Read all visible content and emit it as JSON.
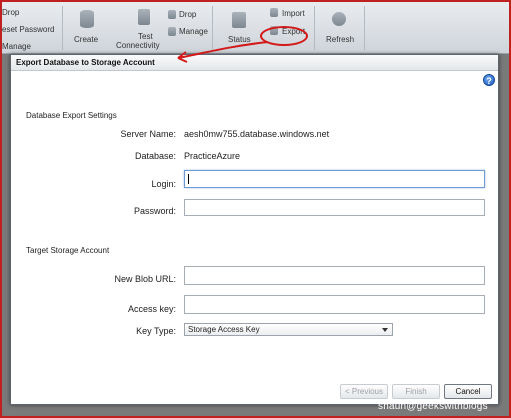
{
  "ribbon": {
    "items": {
      "drop_left": "Drop",
      "reset_password": "eset Password",
      "manage_left": "Manage",
      "create": "Create",
      "test_connectivity_1": "Test",
      "test_connectivity_2": "Connectivity",
      "drop": "Drop",
      "manage": "Manage",
      "status": "Status",
      "import": "Import",
      "export": "Export",
      "refresh": "Refresh"
    },
    "annotation_color": "#d21a1a"
  },
  "dialog": {
    "title": "Export Database to Storage Account",
    "help_icon": "?",
    "export_settings": {
      "section_title": "Database Export Settings",
      "server_name_label": "Server Name:",
      "server_name_value": "aesh0mw755.database.windows.net",
      "database_label": "Database:",
      "database_value": "PracticeAzure",
      "login_label": "Login:",
      "login_value": "",
      "password_label": "Password:",
      "password_value": ""
    },
    "storage": {
      "section_title": "Target Storage Account",
      "blob_url_label": "New Blob URL:",
      "blob_url_value": "",
      "access_key_label": "Access key:",
      "access_key_value": "",
      "key_type_label": "Key Type:",
      "key_type_selected": "Storage Access Key"
    },
    "buttons": {
      "previous": "< Previous",
      "finish": "Finish",
      "cancel": "Cancel"
    }
  },
  "watermark": "shaun@geekswithblogs"
}
